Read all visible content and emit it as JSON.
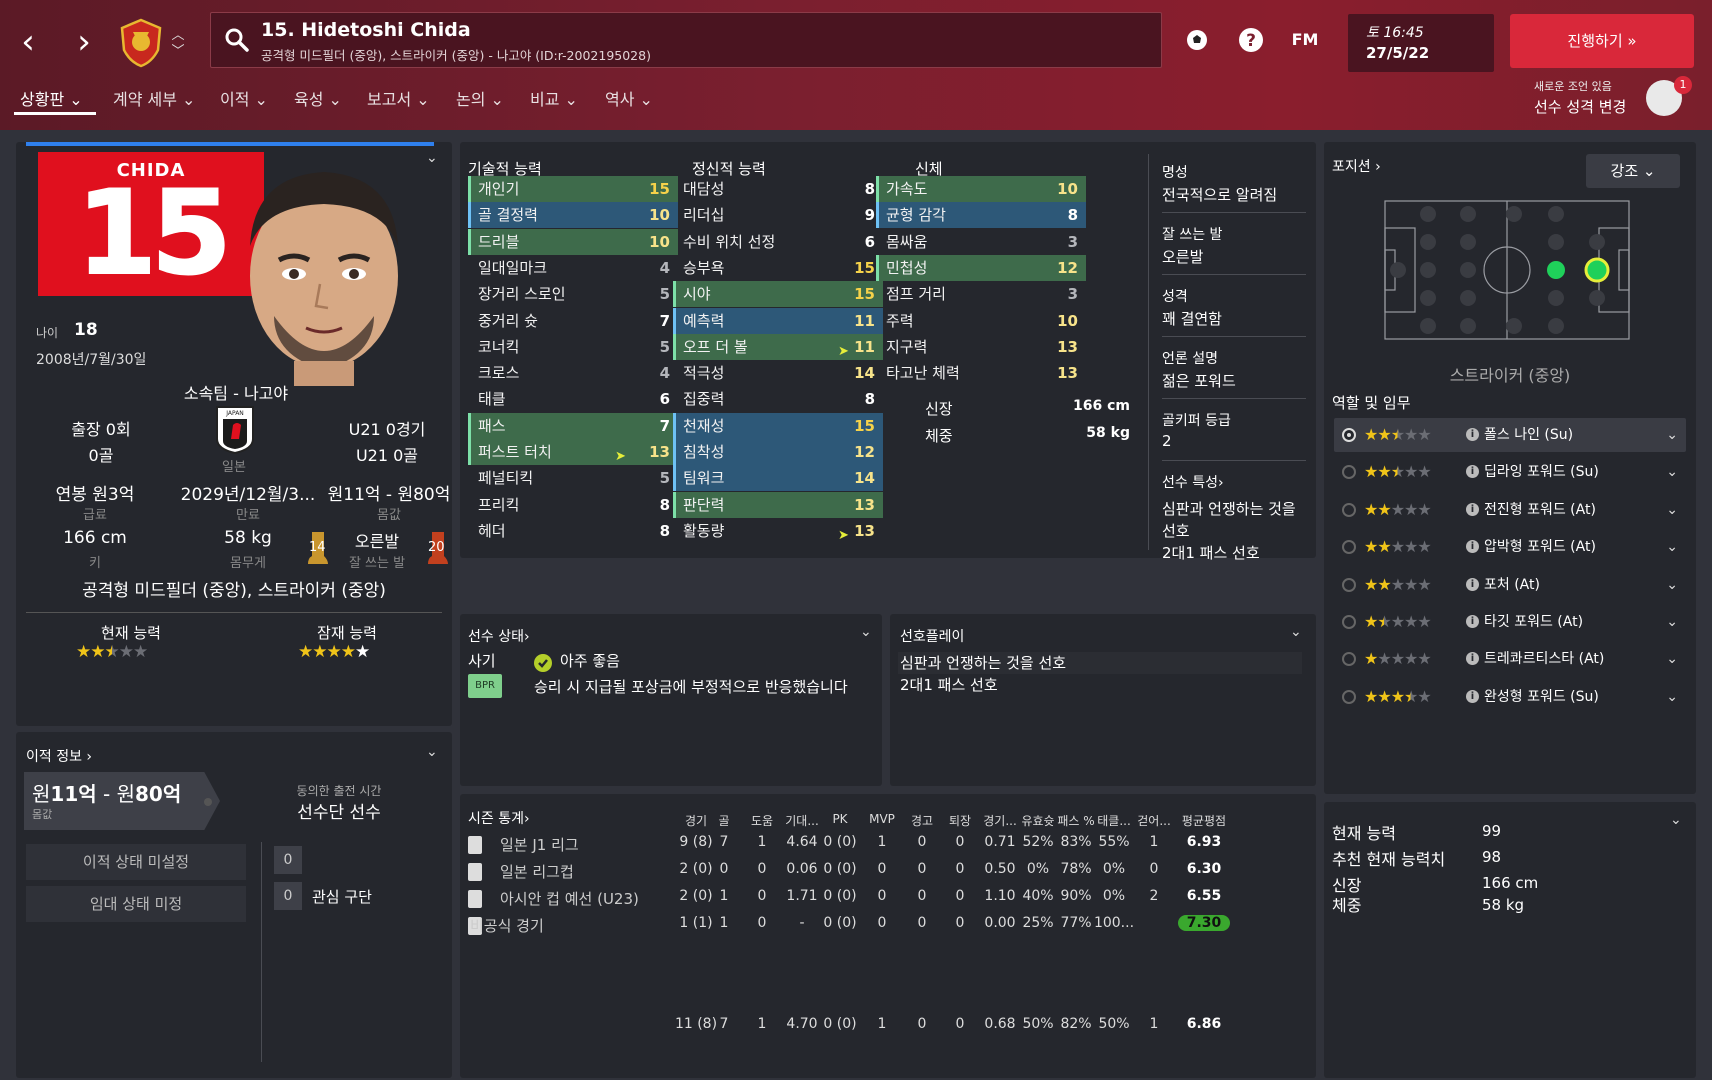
{
  "header": {
    "player_title": "15. Hidetoshi Chida",
    "player_subtitle": "공격형 미드필더 (중앙), 스트라이커 (중앙) - 나고야 (ID:r-2002195028)",
    "fm_label": "FM",
    "day_time": "토 16:45",
    "date": "27/5/22",
    "continue_label": "진행하기 »",
    "advice_small": "새로운 조언 있음",
    "advice_main": "선수 성격 변경",
    "advice_count": "1"
  },
  "menu": [
    "상황판 ⌄",
    "계약 세부 ⌄",
    "이적 ⌄",
    "육성 ⌄",
    "보고서 ⌄",
    "논의 ⌄",
    "비교 ⌄",
    "역사 ⌄"
  ],
  "profile": {
    "shirt_name": "CHIDA",
    "shirt_number": "15",
    "age_label": "나이",
    "age": "18",
    "dob": "2008년/7월/30일",
    "club": "소속팀 - 나고야",
    "apps": "출장 0회",
    "goals": "0골",
    "nation": "일본",
    "u21_apps": "U21 0경기",
    "u21_goals": "U21 0골",
    "wage": "연봉 원3억",
    "wage_lbl": "급료",
    "contract": "2029년/12월/3...",
    "contract_lbl": "만료",
    "value": "원11억 - 원80억",
    "value_lbl": "몸값",
    "height": "166 cm",
    "height_lbl": "키",
    "weight": "58 kg",
    "weight_lbl": "몸무게",
    "foot": "오른발",
    "foot_lbl": "잘 쓰는 발",
    "left_foot": "14",
    "right_foot": "20",
    "position": "공격형 미드필더 (중앙), 스트라이커 (중앙)",
    "ca_label": "현재 능력",
    "pa_label": "잠재 능력",
    "ca_stars": 2.5,
    "pa_stars": 5
  },
  "transfer": {
    "title": "이적 정보 ›",
    "value_prefix": "원",
    "value_a": "11억",
    "value_mid": " - 원",
    "value_b": "80억",
    "value_lbl": "몸값",
    "agreed_lbl": "동의한 출전 시간",
    "agreed_val": "선수단 선수",
    "transfer_status": "이적 상태 미설정",
    "loan_status": "임대 상태 미정",
    "offers_count": "0",
    "interest_count": "0",
    "interest_label": "관심 구단"
  },
  "attributes": {
    "technical_title": "기술적 능력",
    "mental_title": "정신적 능력",
    "physical_title": "신체",
    "technical": [
      {
        "name": "개인기",
        "value": "15",
        "hl": "g"
      },
      {
        "name": "골 결정력",
        "value": "10",
        "hl": "b"
      },
      {
        "name": "드리블",
        "value": "10",
        "hl": "g"
      },
      {
        "name": "일대일마크",
        "value": "4",
        "hl": ""
      },
      {
        "name": "장거리 스로인",
        "value": "5",
        "hl": ""
      },
      {
        "name": "중거리 슛",
        "value": "7",
        "hl": ""
      },
      {
        "name": "코너킥",
        "value": "5",
        "hl": ""
      },
      {
        "name": "크로스",
        "value": "4",
        "hl": ""
      },
      {
        "name": "태클",
        "value": "6",
        "hl": ""
      },
      {
        "name": "패스",
        "value": "7",
        "hl": "g"
      },
      {
        "name": "퍼스트 터치",
        "value": "13",
        "hl": "g"
      },
      {
        "name": "페널티킥",
        "value": "5",
        "hl": ""
      },
      {
        "name": "프리킥",
        "value": "8",
        "hl": ""
      },
      {
        "name": "헤더",
        "value": "8",
        "hl": ""
      }
    ],
    "mental": [
      {
        "name": "대담성",
        "value": "8",
        "hl": ""
      },
      {
        "name": "리더십",
        "value": "9",
        "hl": ""
      },
      {
        "name": "수비 위치 선정",
        "value": "6",
        "hl": ""
      },
      {
        "name": "승부욕",
        "value": "15",
        "hl": ""
      },
      {
        "name": "시야",
        "value": "15",
        "hl": "g"
      },
      {
        "name": "예측력",
        "value": "11",
        "hl": "b"
      },
      {
        "name": "오프 더 볼",
        "value": "11",
        "hl": "g"
      },
      {
        "name": "적극성",
        "value": "14",
        "hl": ""
      },
      {
        "name": "집중력",
        "value": "8",
        "hl": ""
      },
      {
        "name": "천재성",
        "value": "15",
        "hl": "b"
      },
      {
        "name": "침착성",
        "value": "12",
        "hl": "b"
      },
      {
        "name": "팀워크",
        "value": "14",
        "hl": "b"
      },
      {
        "name": "판단력",
        "value": "13",
        "hl": "g"
      },
      {
        "name": "활동량",
        "value": "13",
        "hl": ""
      }
    ],
    "physical": [
      {
        "name": "가속도",
        "value": "10",
        "hl": "g"
      },
      {
        "name": "균형 감각",
        "value": "8",
        "hl": "b"
      },
      {
        "name": "몸싸움",
        "value": "3",
        "hl": ""
      },
      {
        "name": "민첩성",
        "value": "12",
        "hl": "g"
      },
      {
        "name": "점프 거리",
        "value": "3",
        "hl": ""
      },
      {
        "name": "주력",
        "value": "10",
        "hl": ""
      },
      {
        "name": "지구력",
        "value": "13",
        "hl": ""
      },
      {
        "name": "타고난 체력",
        "value": "13",
        "hl": ""
      }
    ],
    "height_lbl": "신장",
    "height_val": "166 cm",
    "weight_lbl": "체중",
    "weight_val": "58 kg"
  },
  "info_col": {
    "rep_lbl": "명성",
    "rep_val": "전국적으로 알려짐",
    "foot_lbl": "잘 쓰는 발",
    "foot_val": "오른발",
    "pers_lbl": "성격",
    "pers_val": "꽤 결연함",
    "media_lbl": "언론 설명",
    "media_val": "젊은 포워드",
    "gk_lbl": "골키퍼 등급",
    "gk_val": "2",
    "traits_lbl": "선수 특성›",
    "trait1a": "심판과 언쟁하는 것을",
    "trait1b": "선호",
    "trait2": "2대1 패스 선호"
  },
  "status": {
    "title": "선수 상태›",
    "morale_lbl": "사기",
    "morale_val": "아주 좋음",
    "bpr": "BPR",
    "note": "승리 시 지급될 포상금에 부정적으로 반응했습니다"
  },
  "preferred": {
    "title": "선호플레이",
    "item1": "심판과 언쟁하는 것을 선호",
    "item2": "2대1 패스 선호"
  },
  "season": {
    "title": "시즌 통계›",
    "headers": [
      "경기",
      "골",
      "도움",
      "기대...",
      "PK",
      "MVP",
      "경고",
      "퇴장",
      "경기...",
      "유효슛",
      "패스 %",
      "태클...",
      "걷어...",
      "평균평점"
    ],
    "rows": [
      {
        "comp": "일본 J1 리그",
        "vals": [
          "9 (8)",
          "7",
          "1",
          "4.64",
          "0 (0)",
          "1",
          "0",
          "0",
          "0.71",
          "52%",
          "83%",
          "55%",
          "1"
        ],
        "rating": "6.93"
      },
      {
        "comp": "일본 리그컵",
        "vals": [
          "2 (0)",
          "0",
          "0",
          "0.06",
          "0 (0)",
          "0",
          "0",
          "0",
          "0.50",
          "0%",
          "78%",
          "0%",
          "0"
        ],
        "rating": "6.30"
      },
      {
        "comp": "아시안 컵 예선 (U23)",
        "vals": [
          "2 (0)",
          "1",
          "0",
          "1.71",
          "0 (0)",
          "0",
          "0",
          "0",
          "1.10",
          "40%",
          "90%",
          "0%",
          "2"
        ],
        "rating": "6.55"
      },
      {
        "comp": "비공식 경기",
        "vals": [
          "1 (1)",
          "1",
          "0",
          "-",
          "0 (0)",
          "0",
          "0",
          "0",
          "0.00",
          "25%",
          "77%",
          "100...",
          ""
        ],
        "rating": "7.30"
      }
    ],
    "total": {
      "vals": [
        "11 (8)",
        "7",
        "1",
        "4.70",
        "0 (0)",
        "1",
        "0",
        "0",
        "0.68",
        "50%",
        "82%",
        "50%",
        "1"
      ],
      "rating": "6.86"
    }
  },
  "positions": {
    "title": "포지션 ›",
    "dropdown": "강조 ⌄",
    "pos_name": "스트라이커 (중앙)",
    "roles_title": "역할 및 임무",
    "roles": [
      {
        "name": "폴스 나인 (Su)",
        "stars": 2.5,
        "sel": true
      },
      {
        "name": "딥라잉 포워드 (Su)",
        "stars": 2.5,
        "sel": false
      },
      {
        "name": "전진형 포워드 (At)",
        "stars": 2,
        "sel": false
      },
      {
        "name": "압박형 포워드 (At)",
        "stars": 2,
        "sel": false
      },
      {
        "name": "포처 (At)",
        "stars": 2,
        "sel": false
      },
      {
        "name": "타깃 포워드 (At)",
        "stars": 1.5,
        "sel": false
      },
      {
        "name": "트레콰르티스타 (At)",
        "stars": 1,
        "sel": false
      },
      {
        "name": "완성형 포워드 (Su)",
        "stars": 3.5,
        "sel": false
      }
    ]
  },
  "summary": {
    "ca_lbl": "현재 능력",
    "ca_val": "99",
    "rca_lbl": "추천 현재 능력치",
    "rca_val": "98",
    "h_lbl": "신장",
    "h_val": "166 cm",
    "w_lbl": "체중",
    "w_val": "58 kg"
  },
  "colors": {
    "accent": "#d9283a",
    "header": "#7a1f2f",
    "green_hl": "#3e6b4b",
    "blue_hl": "#2d5878",
    "star": "#f0c419"
  }
}
